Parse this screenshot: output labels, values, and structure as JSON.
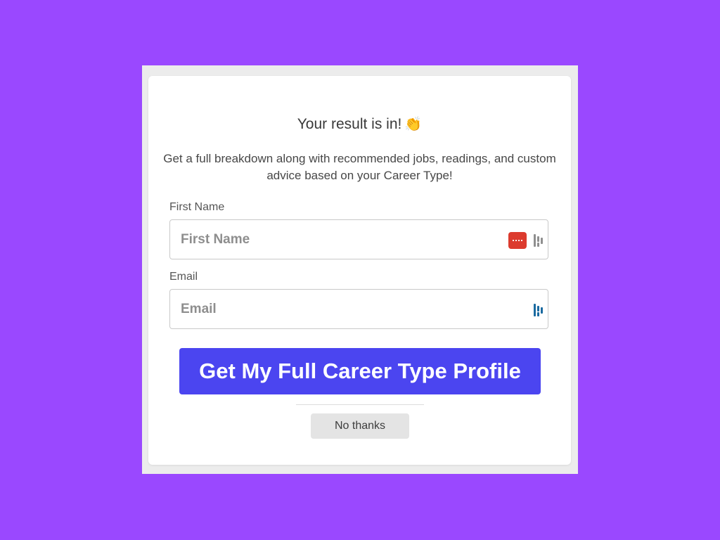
{
  "modal": {
    "title": "Your result is in!",
    "title_emoji": "👏",
    "subtitle": "Get a full breakdown along with recommended jobs, readings, and custom advice based on your Career Type!"
  },
  "form": {
    "first_name": {
      "label": "First Name",
      "placeholder": "First Name",
      "value": ""
    },
    "email": {
      "label": "Email",
      "placeholder": "Email",
      "value": ""
    }
  },
  "actions": {
    "submit_label": "Get My Full Career Type Profile",
    "dismiss_label": "No thanks"
  },
  "colors": {
    "page_background": "#9a48ff",
    "cta_background": "#4b45f0",
    "password_manager_icon": "#dc3b2e",
    "extension_icon_active": "#1a6aa0"
  },
  "icons": {
    "first_name_icons": [
      "password-manager-icon",
      "autofill-extension-icon"
    ],
    "email_icons": [
      "autofill-extension-icon"
    ]
  }
}
